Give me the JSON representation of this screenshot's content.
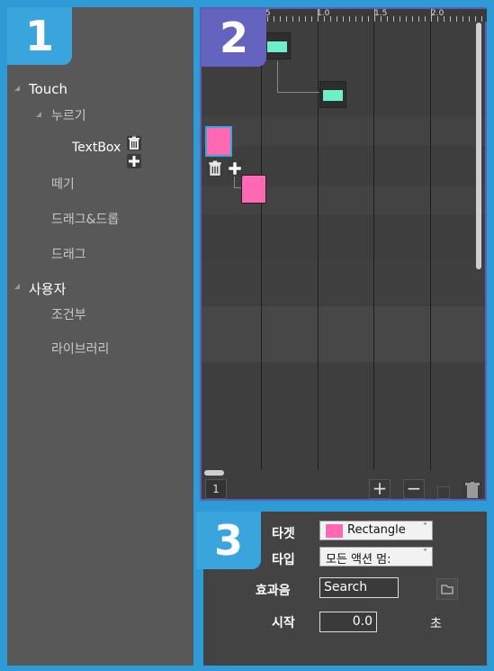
{
  "badges": [
    "1",
    "2",
    "3"
  ],
  "tree": {
    "items": [
      {
        "label": "Touch",
        "level": 0
      },
      {
        "label": "누르기",
        "level": 1
      },
      {
        "label": "TextBox",
        "level": 2
      },
      {
        "label": "떼기",
        "level": 1
      },
      {
        "label": "드래그&드롭",
        "level": 1
      },
      {
        "label": "드래그",
        "level": 1
      },
      {
        "label": "사용자",
        "level": 0
      },
      {
        "label": "조건부",
        "level": 1
      },
      {
        "label": "라이브러리",
        "level": 1
      }
    ]
  },
  "timeline": {
    "ruler_labels": [
      ".5",
      "1.0",
      "1.5",
      "2.0"
    ],
    "page_number": "1",
    "add_label": "+",
    "remove_label": "−"
  },
  "properties": {
    "target_label": "타겟",
    "target_value": "Rectangle",
    "type_label": "타입",
    "type_value": "모든 액션 멈:",
    "sound_label": "효과음",
    "sound_value": "Search",
    "start_label": "시작",
    "start_value": "0.0",
    "start_unit": "초"
  },
  "colors": {
    "accent_blue": "#3aa5dc",
    "accent_purple": "#6463c0",
    "key_green": "#6fefc9",
    "pink": "#ff69b3"
  }
}
